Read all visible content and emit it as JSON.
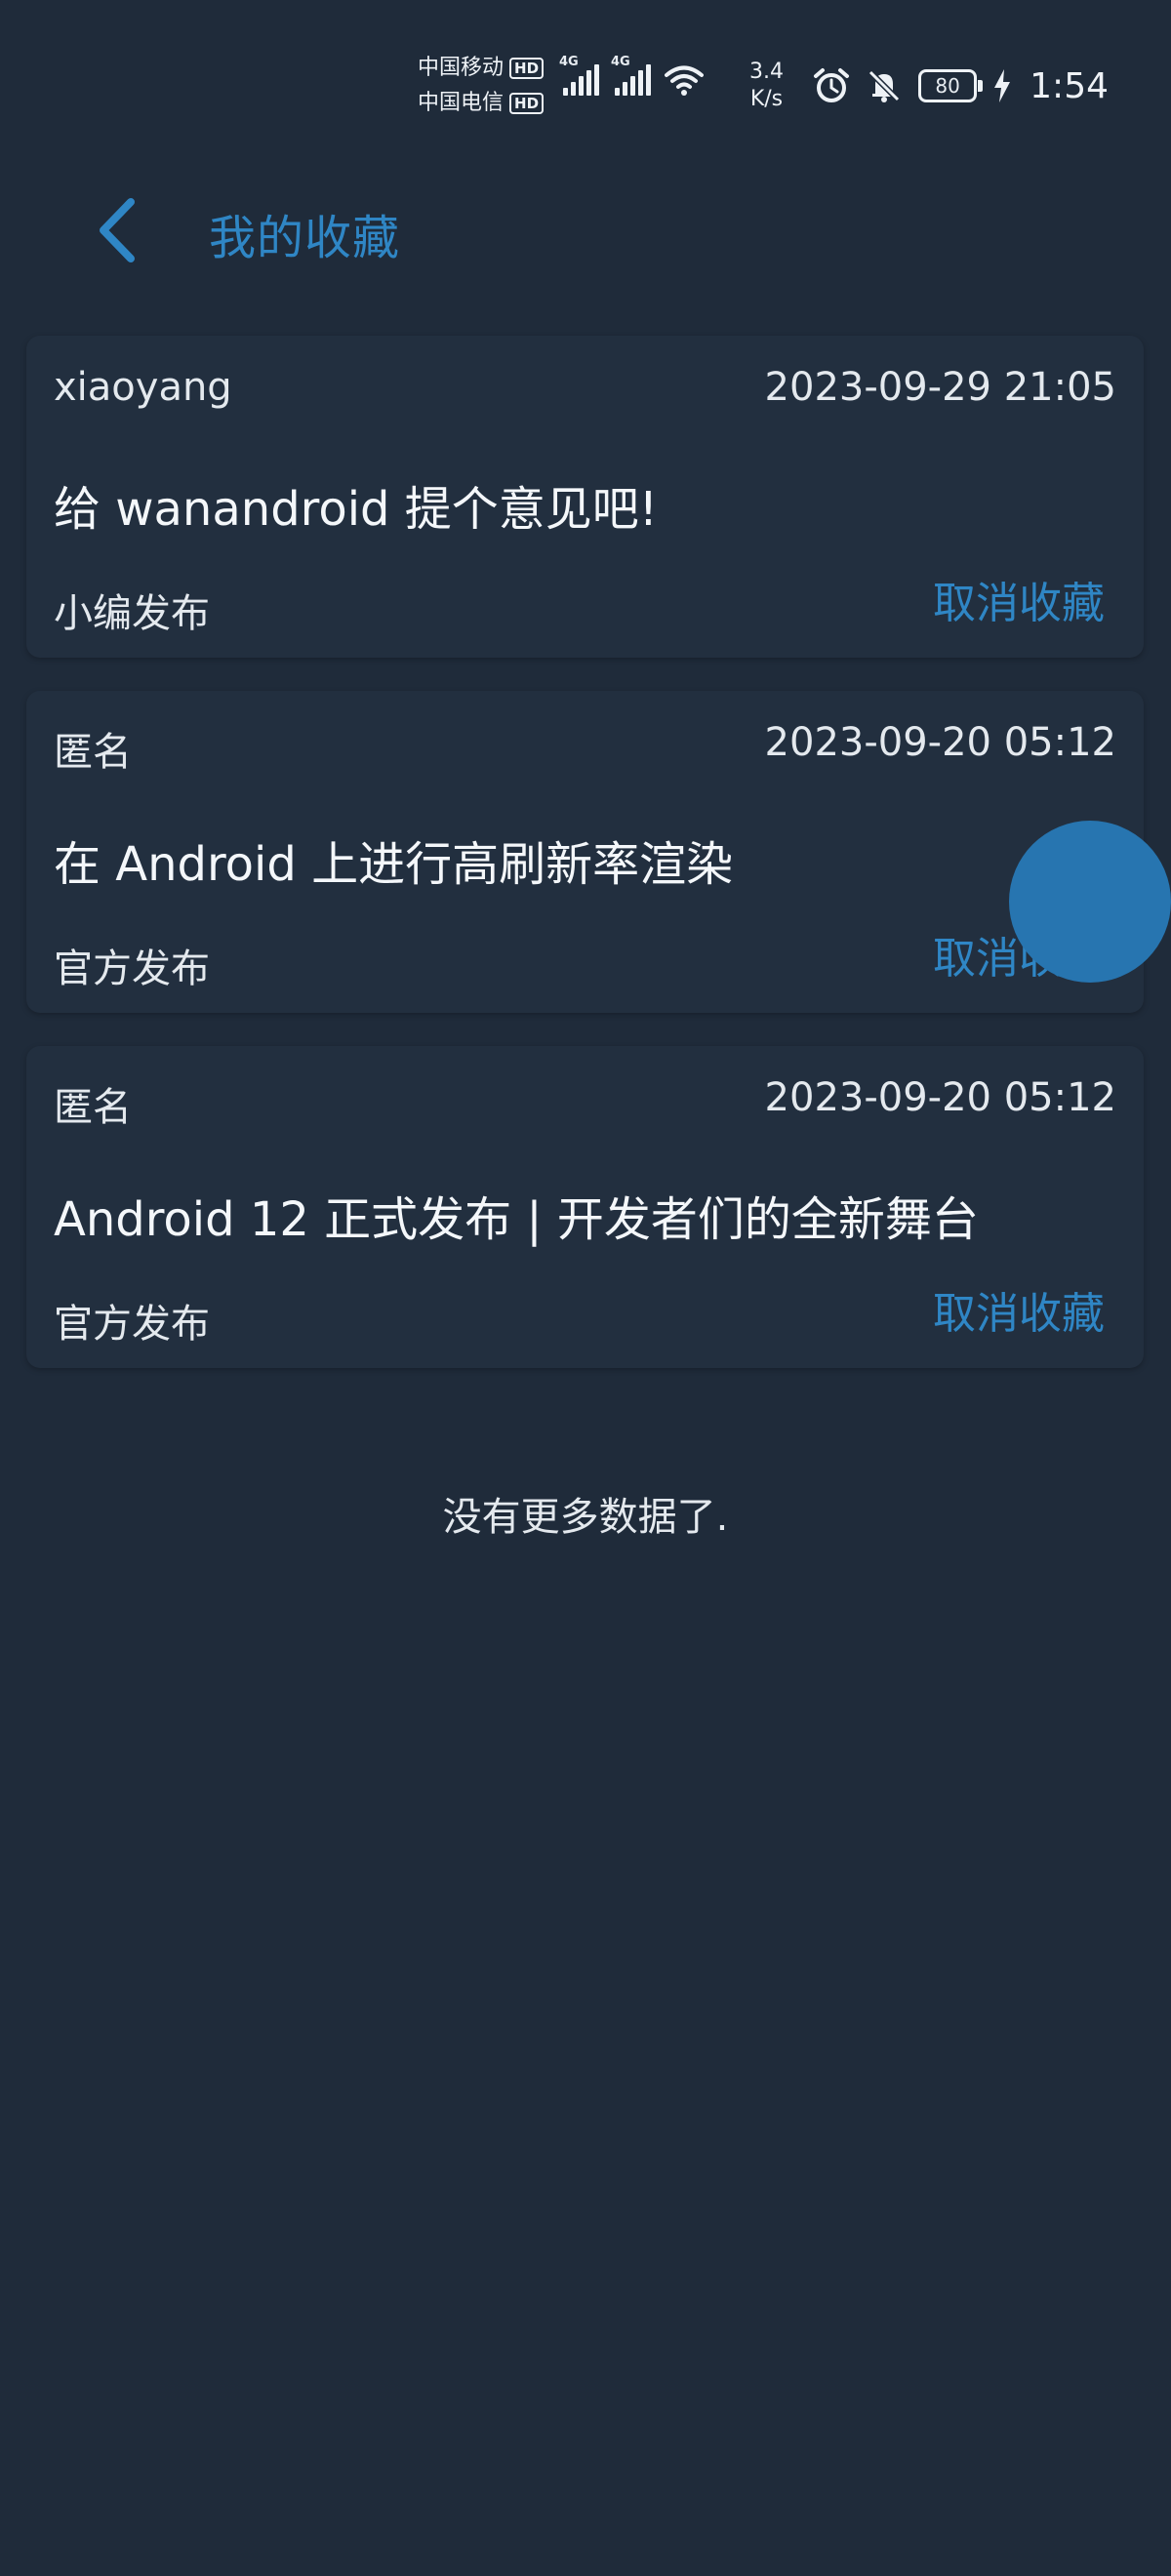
{
  "status_bar": {
    "carrier1": "中国移动",
    "carrier2": "中国电信",
    "hd_badge": "HD",
    "network_tag": "4G",
    "net_speed_value": "3.4",
    "net_speed_unit": "K/s",
    "battery_level": "80",
    "time": "1:54"
  },
  "header": {
    "title": "我的收藏",
    "accent_color": "#2f86c5"
  },
  "collections": [
    {
      "author": "xiaoyang",
      "date": "2023-09-29 21:05",
      "title": "给 wanandroid 提个意见吧!",
      "source": "小编发布",
      "action_label": "取消收藏"
    },
    {
      "author": "匿名",
      "date": "2023-09-20 05:12",
      "title": "在 Android 上进行高刷新率渲染",
      "source": "官方发布",
      "action_label": "取消收藏"
    },
    {
      "author": "匿名",
      "date": "2023-09-20 05:12",
      "title": "Android 12 正式发布 | 开发者们的全新舞台",
      "source": "官方发布",
      "action_label": "取消收藏"
    }
  ],
  "footer": {
    "no_more_text": "没有更多数据了."
  },
  "colors": {
    "background": "#1f2b3a",
    "card": "#222f3f",
    "accent": "#2f86c5",
    "fab": "#2775b0"
  }
}
